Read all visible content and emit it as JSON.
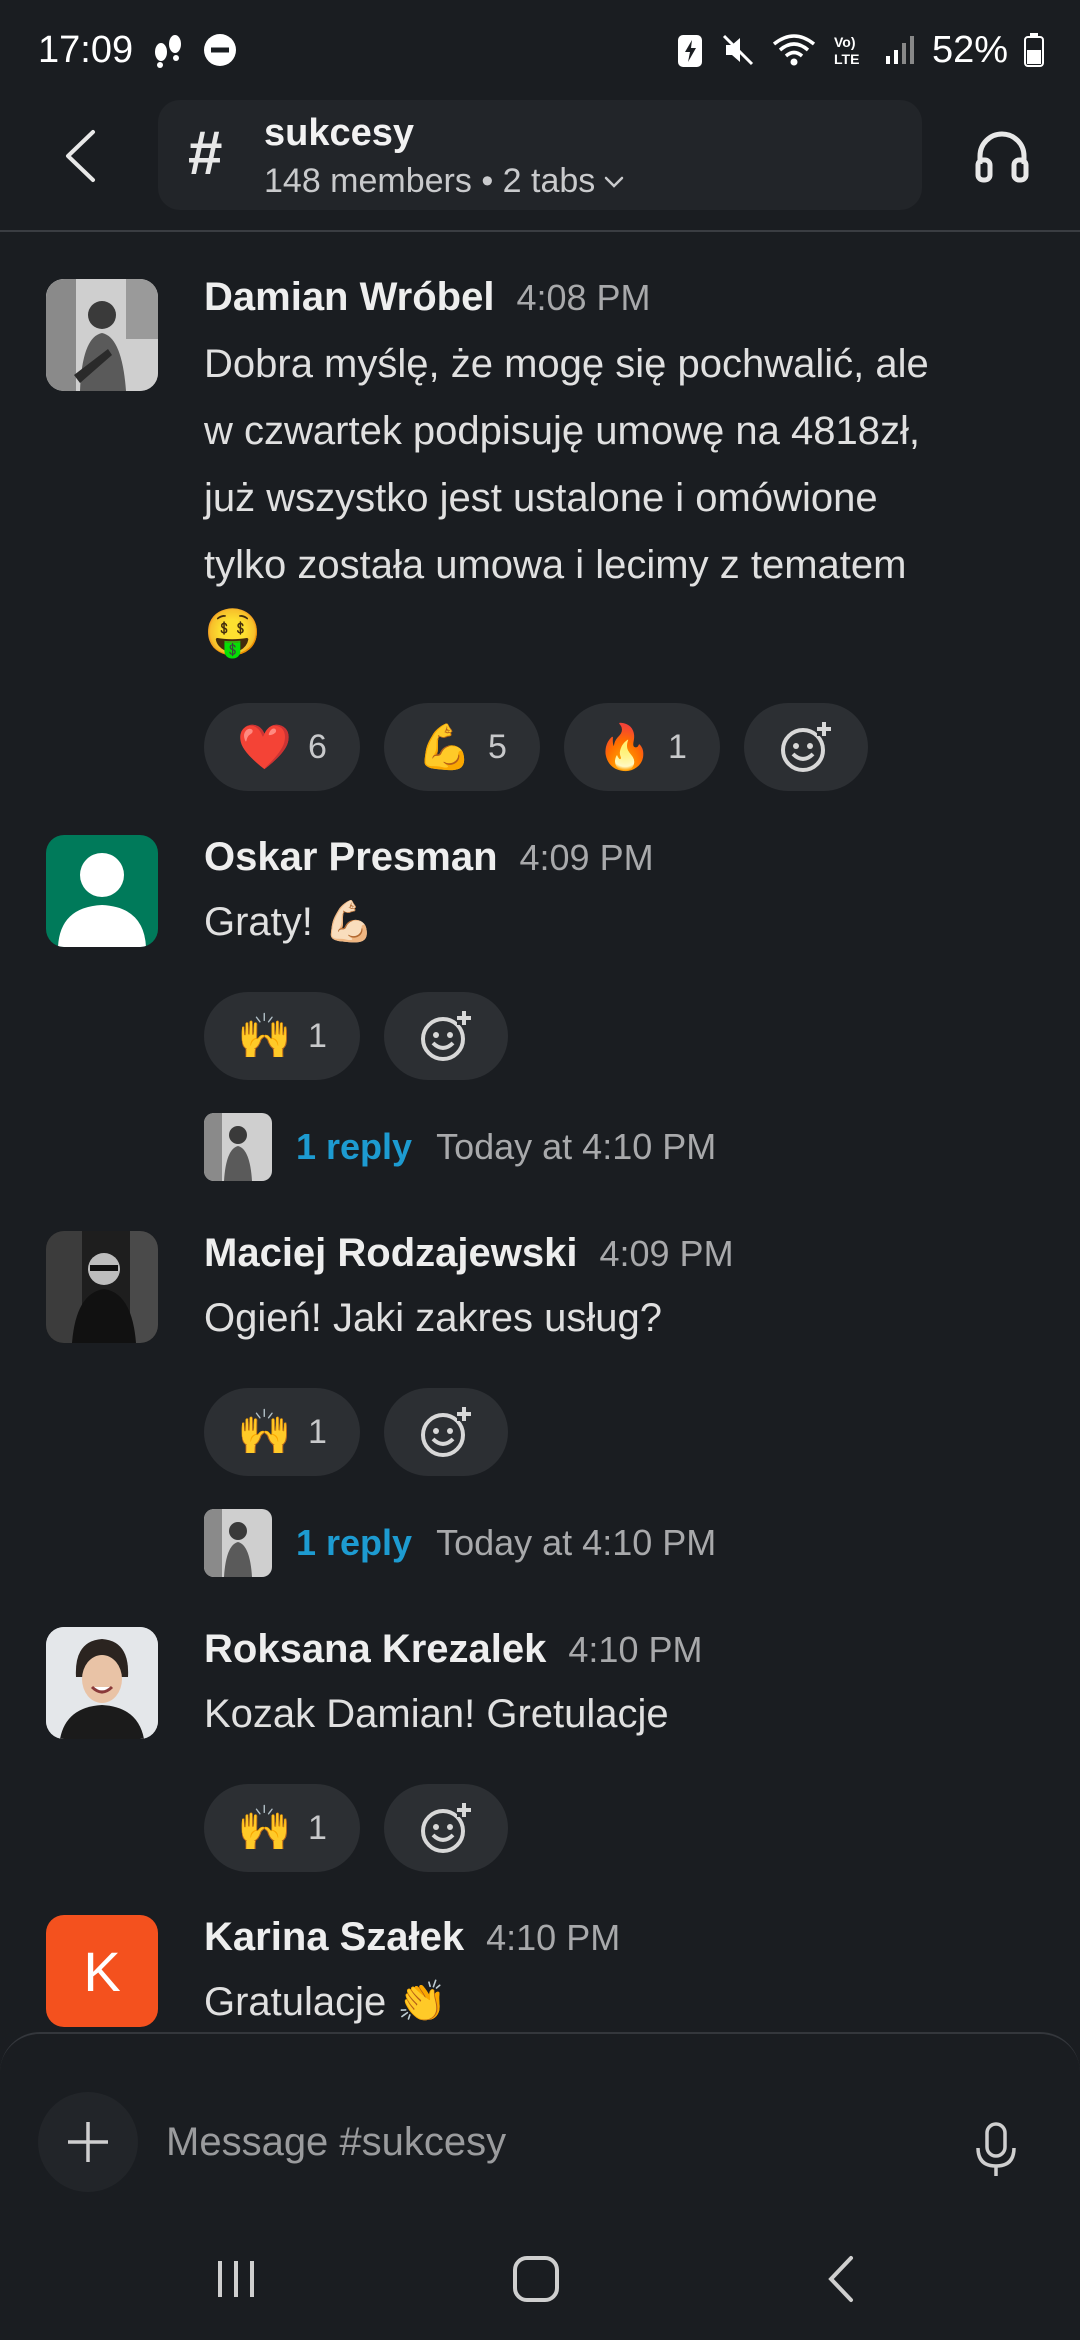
{
  "status_bar": {
    "time": "17:09",
    "battery": "52%"
  },
  "header": {
    "channel_name": "sukcesy",
    "channel_meta": "148 members • 2 tabs",
    "hash_symbol": "#"
  },
  "messages": [
    {
      "author": "Damian Wróbel",
      "time": "4:08 PM",
      "text_lines": [
        "Dobra myślę, że mogę się pochwalić, ale",
        "w czwartek podpisuję umowę na 4818zł,",
        "już wszystko jest ustalone i omówione",
        "tylko została umowa i lecimy z tematem",
        "🤑"
      ],
      "reactions": [
        {
          "emoji": "❤️",
          "count": "6"
        },
        {
          "emoji": "💪",
          "count": "5"
        },
        {
          "emoji": "🔥",
          "count": "1"
        }
      ]
    },
    {
      "author": "Oskar Presman",
      "time": "4:09 PM",
      "text": "Graty! 💪🏻",
      "reactions": [
        {
          "emoji": "🙌",
          "count": "1"
        }
      ],
      "thread": {
        "replies": "1 reply",
        "time": "Today at 4:10 PM"
      }
    },
    {
      "author": "Maciej Rodzajewski",
      "time": "4:09 PM",
      "text": "Ogień! Jaki zakres usług?",
      "reactions": [
        {
          "emoji": "🙌",
          "count": "1"
        }
      ],
      "thread": {
        "replies": "1 reply",
        "time": "Today at 4:10 PM"
      }
    },
    {
      "author": "Roksana Krezalek",
      "time": "4:10 PM",
      "text": "Kozak Damian! Gretulacje",
      "reactions": [
        {
          "emoji": "🙌",
          "count": "1"
        }
      ]
    },
    {
      "author": "Karina Szałek",
      "time": "4:10 PM",
      "text": "Gratulacje 👏",
      "avatar_letter": "K"
    }
  ],
  "composer": {
    "placeholder": "Message #sukcesy"
  },
  "colors": {
    "background": "#1a1d21",
    "link": "#1d9bd1",
    "avatar_green": "#007a5a",
    "avatar_orange": "#f4511e"
  }
}
